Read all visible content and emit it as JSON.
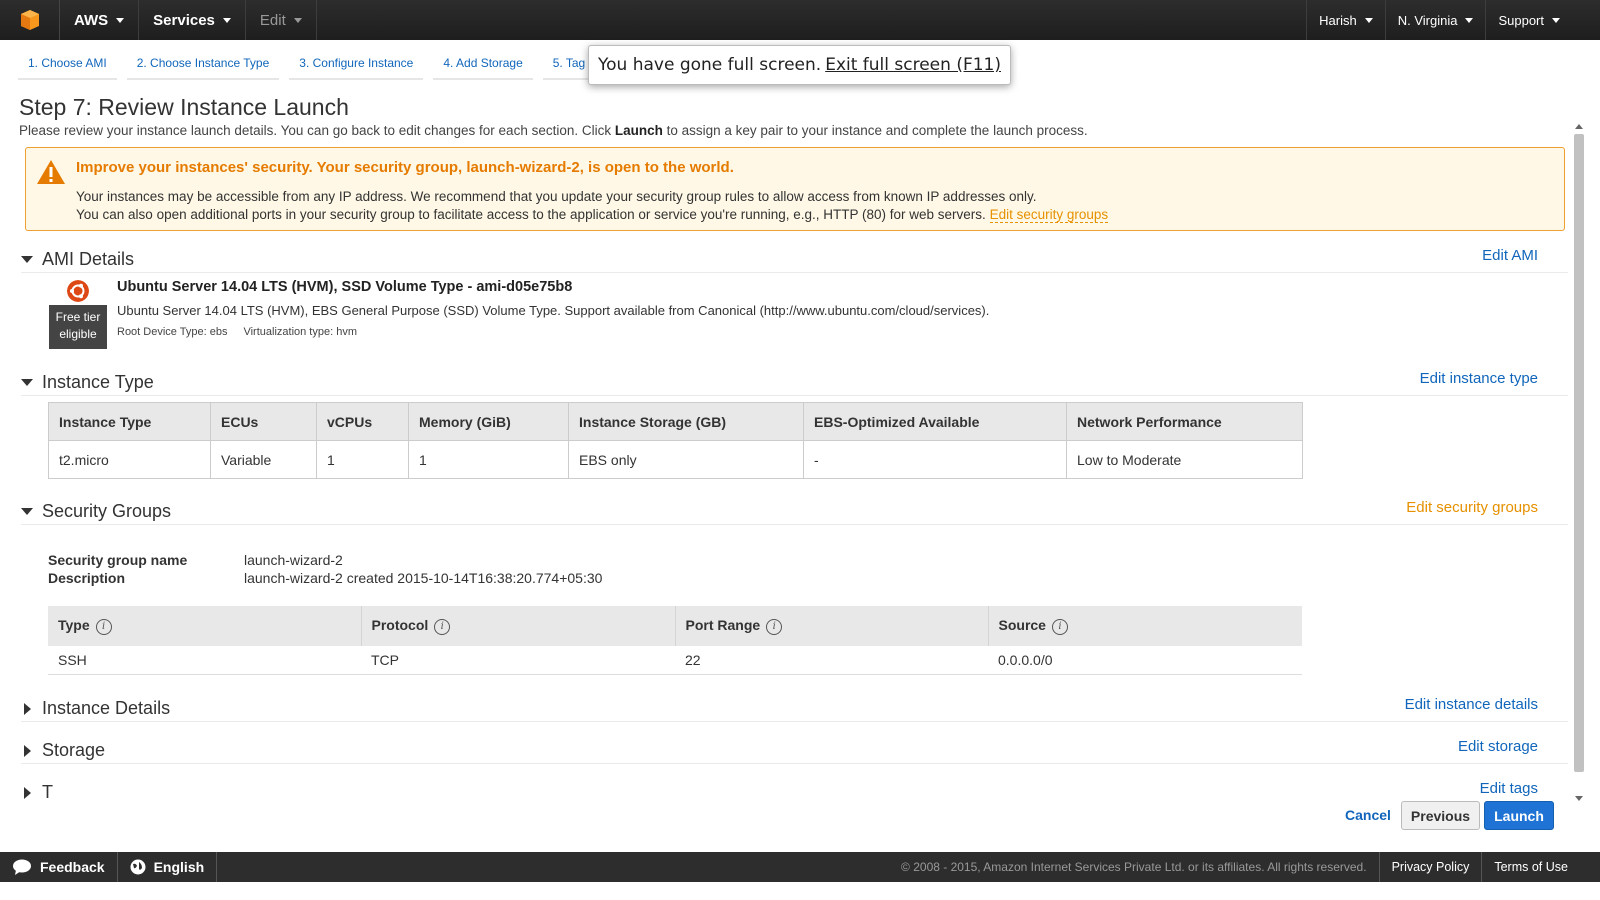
{
  "nav": {
    "brand": "AWS",
    "services": "Services",
    "edit": "Edit",
    "user": "Harish",
    "region": "N. Virginia",
    "support": "Support"
  },
  "steps": [
    "1. Choose AMI",
    "2. Choose Instance Type",
    "3. Configure Instance",
    "4. Add Storage",
    "5. Tag"
  ],
  "fullscreen": {
    "message": "You have gone full screen.",
    "exit": "Exit full screen (F11)"
  },
  "page": {
    "title": "Step 7: Review Instance Launch",
    "subtitle_pre": "Please review your instance launch details. You can go back to edit changes for each section. Click ",
    "subtitle_bold": "Launch",
    "subtitle_post": " to assign a key pair to your instance and complete the launch process."
  },
  "warning": {
    "title": "Improve your instances' security. Your security group, launch-wizard-2, is open to the world.",
    "line1": "Your instances may be accessible from any IP address. We recommend that you update your security group rules to allow access from known IP addresses only.",
    "line2": "You can also open additional ports in your security group to facilitate access to the application or service you're running, e.g., HTTP (80) for web servers.",
    "link": "Edit security groups"
  },
  "ami": {
    "heading": "AMI Details",
    "edit": "Edit AMI",
    "tag_line1": "Free tier",
    "tag_line2": "eligible",
    "name": "Ubuntu Server 14.04 LTS (HVM), SSD Volume Type - ami-d05e75b8",
    "description": "Ubuntu Server 14.04 LTS (HVM), EBS General Purpose (SSD) Volume Type. Support available from Canonical (http://www.ubuntu.com/cloud/services).",
    "root_device": "Root Device Type: ebs",
    "virtualization": "Virtualization type: hvm"
  },
  "instance_type": {
    "heading": "Instance Type",
    "edit": "Edit instance type",
    "columns": [
      "Instance Type",
      "ECUs",
      "vCPUs",
      "Memory (GiB)",
      "Instance Storage (GB)",
      "EBS-Optimized Available",
      "Network Performance"
    ],
    "row": [
      "t2.micro",
      "Variable",
      "1",
      "1",
      "EBS only",
      "-",
      "Low to Moderate"
    ]
  },
  "security_groups": {
    "heading": "Security Groups",
    "edit": "Edit security groups",
    "name_label": "Security group name",
    "name_value": "launch-wizard-2",
    "desc_label": "Description",
    "desc_value": "launch-wizard-2 created 2015-10-14T16:38:20.774+05:30",
    "columns": [
      "Type",
      "Protocol",
      "Port Range",
      "Source"
    ],
    "row": [
      "SSH",
      "TCP",
      "22",
      "0.0.0.0/0"
    ]
  },
  "instance_details": {
    "heading": "Instance Details",
    "edit": "Edit instance details"
  },
  "storage": {
    "heading": "Storage",
    "edit": "Edit storage"
  },
  "tags": {
    "heading": "T",
    "edit": "Edit tags"
  },
  "buttons": {
    "cancel": "Cancel",
    "previous": "Previous",
    "launch": "Launch"
  },
  "footer": {
    "feedback": "Feedback",
    "language": "English",
    "copyright": "© 2008 - 2015, Amazon Internet Services Private Ltd. or its affiliates. All rights reserved.",
    "privacy": "Privacy Policy",
    "terms": "Terms of Use"
  },
  "colors": {
    "accent_blue": "#1166bb",
    "warning_orange": "#e57b00",
    "launch_blue": "#1e73d4"
  }
}
